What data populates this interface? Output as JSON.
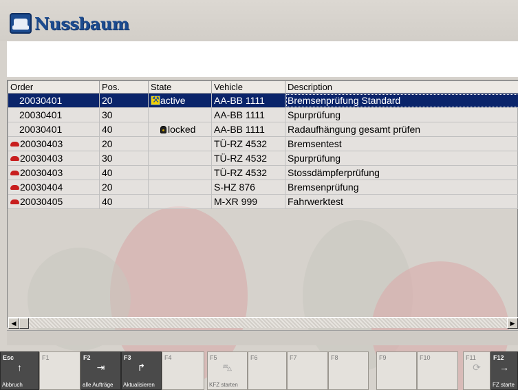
{
  "app": {
    "brand": "Nussbaum"
  },
  "table": {
    "headers": [
      "Order",
      "Pos.",
      "State",
      "Vehicle",
      "Description"
    ],
    "rows": [
      {
        "order": "20030401",
        "pos": "20",
        "state": "active",
        "vehicle": "AA-BB 1111",
        "description": "Bremsenprüfung Standard",
        "car": false,
        "icon": "active"
      },
      {
        "order": "20030401",
        "pos": "30",
        "state": "",
        "vehicle": "AA-BB 1111",
        "description": "Spurprüfung",
        "car": false,
        "icon": ""
      },
      {
        "order": "20030401",
        "pos": "40",
        "state": "locked",
        "vehicle": "AA-BB 1111",
        "description": "Radaufhängung gesamt prüfen",
        "car": false,
        "icon": "locked"
      },
      {
        "order": "20030403",
        "pos": "20",
        "state": "",
        "vehicle": "TÜ-RZ 4532",
        "description": "Bremsentest",
        "car": true,
        "icon": ""
      },
      {
        "order": "20030403",
        "pos": "30",
        "state": "",
        "vehicle": "TÜ-RZ 4532",
        "description": "Spurprüfung",
        "car": true,
        "icon": ""
      },
      {
        "order": "20030403",
        "pos": "40",
        "state": "",
        "vehicle": "TÜ-RZ 4532",
        "description": "Stossdämpferprüfung",
        "car": true,
        "icon": ""
      },
      {
        "order": "20030404",
        "pos": "20",
        "state": "",
        "vehicle": "S-HZ 876",
        "description": "Bremsenprüfung",
        "car": true,
        "icon": ""
      },
      {
        "order": "20030405",
        "pos": "40",
        "state": "",
        "vehicle": "M-XR 999",
        "description": "Fahrwerktest",
        "car": true,
        "icon": ""
      }
    ]
  },
  "fkeys": [
    {
      "key": "Esc",
      "label": "Abbruch",
      "icon": "up-arrow-icon",
      "glyph": "↑",
      "dark": true
    },
    {
      "key": "F1",
      "label": "",
      "icon": "",
      "glyph": "",
      "dark": false
    },
    {
      "key": "F2",
      "label": "alle Aufträge",
      "icon": "list-arrow-icon",
      "glyph": "⇥",
      "dark": true
    },
    {
      "key": "F3",
      "label": "Aktualisieren",
      "icon": "refresh-list-icon",
      "glyph": "↱",
      "dark": true
    },
    {
      "key": "F4",
      "label": "",
      "icon": "",
      "glyph": "",
      "dark": false
    },
    {
      "key": "F5",
      "label": "KFZ starten",
      "icon": "car-icon",
      "glyph": "⛍",
      "dark": false
    },
    {
      "key": "F6",
      "label": "",
      "icon": "",
      "glyph": "",
      "dark": false
    },
    {
      "key": "F7",
      "label": "",
      "icon": "",
      "glyph": "",
      "dark": false
    },
    {
      "key": "F8",
      "label": "",
      "icon": "",
      "glyph": "",
      "dark": false
    },
    {
      "key": "F9",
      "label": "",
      "icon": "",
      "glyph": "",
      "dark": false
    },
    {
      "key": "F10",
      "label": "",
      "icon": "",
      "glyph": "",
      "dark": false
    },
    {
      "key": "F11",
      "label": "",
      "icon": "cycle-icon",
      "glyph": "⟳",
      "dark": false
    },
    {
      "key": "F12",
      "label": "FZ starte",
      "icon": "right-arrow-icon",
      "glyph": "→",
      "dark": true
    }
  ],
  "colors": {
    "selection": "#0a246a",
    "brand": "#1c4b8f",
    "car": "#c81e1e",
    "active": "#f4d000"
  }
}
